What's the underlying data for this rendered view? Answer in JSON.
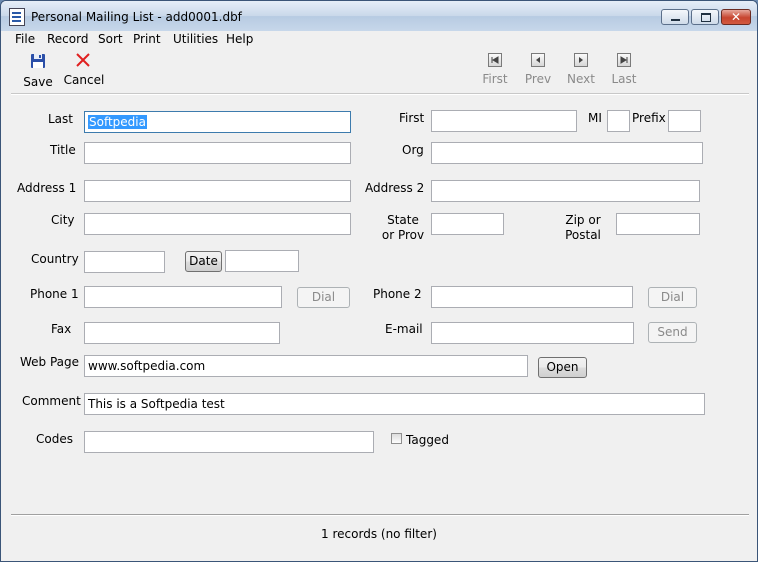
{
  "window": {
    "title": "Personal Mailing List - add0001.dbf",
    "close_glyph": "✕"
  },
  "menu": [
    "File",
    "Record",
    "Sort",
    "Print",
    "Utilities",
    "Help"
  ],
  "toolbar": {
    "save": "Save",
    "cancel": "Cancel",
    "nav": [
      "First",
      "Prev",
      "Next",
      "Last"
    ]
  },
  "form": {
    "last_label": "Last",
    "last_value": "Softpedia",
    "first_label": "First",
    "first_value": "",
    "mi_label": "MI",
    "mi_value": "",
    "prefix_label": "Prefix",
    "prefix_value": "",
    "title_label": "Title",
    "title_value": "",
    "org_label": "Org",
    "org_value": "",
    "address1_label": "Address 1",
    "address1_value": "",
    "address2_label": "Address 2",
    "address2_value": "",
    "city_label": "City",
    "city_value": "",
    "state_label_1": "State",
    "state_label_2": "or Prov",
    "state_value": "",
    "zip_label_1": "Zip or",
    "zip_label_2": "Postal",
    "zip_value": "",
    "country_label": "Country",
    "country_value": "",
    "date_button": "Date",
    "date_value": "",
    "phone1_label": "Phone 1",
    "phone1_value": "",
    "dial1_button": "Dial",
    "phone2_label": "Phone 2",
    "phone2_value": "",
    "dial2_button": "Dial",
    "fax_label": "Fax",
    "fax_value": "",
    "email_label": "E-mail",
    "email_value": "",
    "send_button": "Send",
    "webpage_label": "Web Page",
    "webpage_value": "www.softpedia.com",
    "open_button": "Open",
    "comment_label": "Comment",
    "comment_value": "This is a Softpedia test",
    "codes_label": "Codes",
    "codes_value": "",
    "tagged_label": "Tagged",
    "tagged_checked": false
  },
  "status": "1 records (no filter)"
}
